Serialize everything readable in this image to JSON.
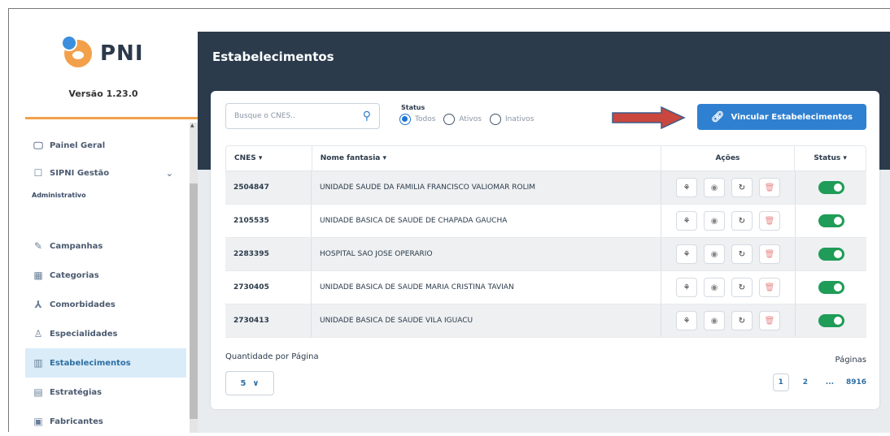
{
  "app": {
    "name": "PNI",
    "version": "Versão 1.23.0"
  },
  "sidebar": {
    "items": [
      {
        "label": "Painel Geral",
        "icon": "monitor-icon"
      },
      {
        "label": "SIPNI Gestão",
        "icon": "document-icon"
      },
      {
        "label": "Campanhas",
        "icon": "syringe-icon"
      },
      {
        "label": "Categorias",
        "icon": "categories-icon"
      },
      {
        "label": "Comorbidades",
        "icon": "nodes-icon"
      },
      {
        "label": "Especialidades",
        "icon": "specialties-icon"
      },
      {
        "label": "Estabelecimentos",
        "icon": "building-icon",
        "active": true
      },
      {
        "label": "Estratégias",
        "icon": "strategy-icon"
      },
      {
        "label": "Fabricantes",
        "icon": "factory-icon"
      }
    ],
    "section_label": "Administrativo"
  },
  "page": {
    "title": "Estabelecimentos"
  },
  "search": {
    "placeholder": "Busque o CNES.."
  },
  "status_filter": {
    "label": "Status",
    "options": [
      "Todos",
      "Ativos",
      "Inativos"
    ],
    "selected": "Todos"
  },
  "link_button": {
    "label": "Vincular Estabelecimentos"
  },
  "table": {
    "headers": {
      "cnes": "CNES ▾",
      "nome": "Nome fantasia ▾",
      "acoes": "Ações",
      "status": "Status ▾"
    },
    "rows": [
      {
        "cnes": "2504847",
        "nome": "UNIDADE SAUDE DA FAMILIA FRANCISCO VALIOMAR ROLIM",
        "active": true
      },
      {
        "cnes": "2105535",
        "nome": "UNIDADE BASICA DE SAUDE DE CHAPADA GAUCHA",
        "active": true
      },
      {
        "cnes": "2283395",
        "nome": "HOSPITAL SAO JOSE OPERARIO",
        "active": true
      },
      {
        "cnes": "2730405",
        "nome": "UNIDADE BASICA DE SAUDE MARIA CRISTINA TAVIAN",
        "active": true
      },
      {
        "cnes": "2730413",
        "nome": "UNIDADE BASICA DE SAUDE VILA IGUACU",
        "active": true
      }
    ]
  },
  "pagination": {
    "per_page_label": "Quantidade por Página",
    "per_page_value": "5",
    "pages_label": "Páginas",
    "pages": [
      "1",
      "2",
      "...",
      "8916"
    ],
    "current": "1"
  },
  "colors": {
    "header_bg": "#2b3b4c",
    "accent": "#2f80d1",
    "active_toggle": "#1f9c57",
    "logo_orange": "#f3a04b"
  }
}
